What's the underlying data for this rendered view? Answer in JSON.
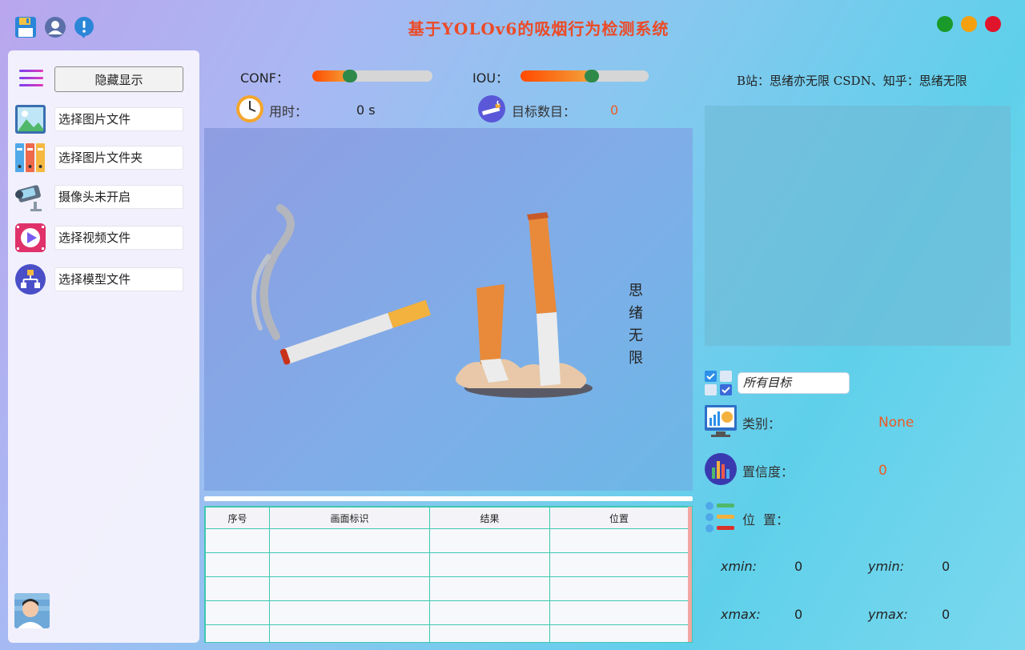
{
  "app": {
    "title": "基于YOLOv6的吸烟行为检测系统",
    "top_icons": [
      "save-icon",
      "user-icon",
      "info-icon"
    ],
    "window_controls": [
      {
        "name": "maximize",
        "color": "#1a9a2a"
      },
      {
        "name": "minimize",
        "color": "#f5a00f"
      },
      {
        "name": "close",
        "color": "#e0142a"
      }
    ]
  },
  "sidebar": {
    "hide_button": "隐藏显示",
    "items": [
      {
        "label": "选择图片文件",
        "icon": "image-file-icon"
      },
      {
        "label": "选择图片文件夹",
        "icon": "folder-binders-icon"
      },
      {
        "label": "摄像头未开启",
        "icon": "camera-icon"
      },
      {
        "label": "选择视频文件",
        "icon": "video-play-icon"
      },
      {
        "label": "选择模型文件",
        "icon": "model-network-icon"
      }
    ]
  },
  "params": {
    "conf_label": "CONF：",
    "conf_value": 0.25,
    "iou_label": "IOU：",
    "iou_value": 0.5,
    "time_label": "用时：",
    "time_value": "0 s",
    "count_label": "目标数目：",
    "count_value": "0"
  },
  "image_panel": {
    "watermark": [
      "思",
      "绪",
      "无",
      "限"
    ]
  },
  "table": {
    "headers": [
      "序号",
      "画面标识",
      "结果",
      "位置"
    ],
    "rows": [
      [
        "",
        "",
        "",
        ""
      ],
      [
        "",
        "",
        "",
        ""
      ],
      [
        "",
        "",
        "",
        ""
      ],
      [
        "",
        "",
        "",
        ""
      ],
      [
        "",
        "",
        "",
        ""
      ]
    ]
  },
  "right": {
    "credits": "B站：思绪亦无限  CSDN、知乎：思绪无限",
    "target_select": "所有目标",
    "class_label": "类别：",
    "class_value": "None",
    "confidence_label": "置信度：",
    "confidence_value": "0",
    "position_label": "位  置：",
    "xmin_label": "xmin:",
    "xmin_value": "0",
    "ymin_label": "ymin:",
    "ymin_value": "0",
    "xmax_label": "xmax:",
    "xmax_value": "0",
    "ymax_label": "ymax:",
    "ymax_value": "0"
  },
  "colors": {
    "accent_orange": "#ec5a22",
    "title_red": "#ec4a26",
    "table_border": "#3ec8b0"
  }
}
